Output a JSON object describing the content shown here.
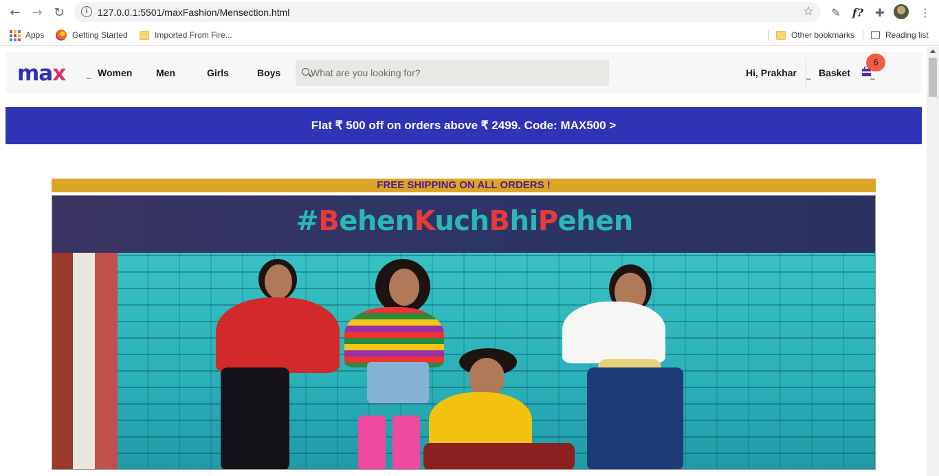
{
  "browser": {
    "url": "127.0.0.1:5501/maxFashion/Mensection.html",
    "bookmarks": {
      "apps": "Apps",
      "getting_started": "Getting Started",
      "imported": "Imported From Fire...",
      "other": "Other bookmarks",
      "reading_list": "Reading list"
    }
  },
  "header": {
    "logo_text": "max",
    "nav": [
      "Women",
      "Men",
      "Girls",
      "Boys"
    ],
    "search_placeholder": "What are you looking for?",
    "greeting": "Hi, Prakhar",
    "basket_label": "Basket",
    "basket_count": "6"
  },
  "promo": {
    "text": "Flat ₹ 500 off on orders above ₹ 2499. Code: MAX500 >"
  },
  "shipping": {
    "text": "FREE SHIPPING ON ALL ORDERS !"
  },
  "hero": {
    "hashtag_parts": [
      "#",
      "B",
      "ehen",
      "K",
      "uch",
      "B",
      "hi",
      "P",
      "ehen"
    ]
  },
  "colors": {
    "brand_blue": "#2f34b6",
    "shipping_bg": "#dba628",
    "badge": "#f45b45"
  }
}
